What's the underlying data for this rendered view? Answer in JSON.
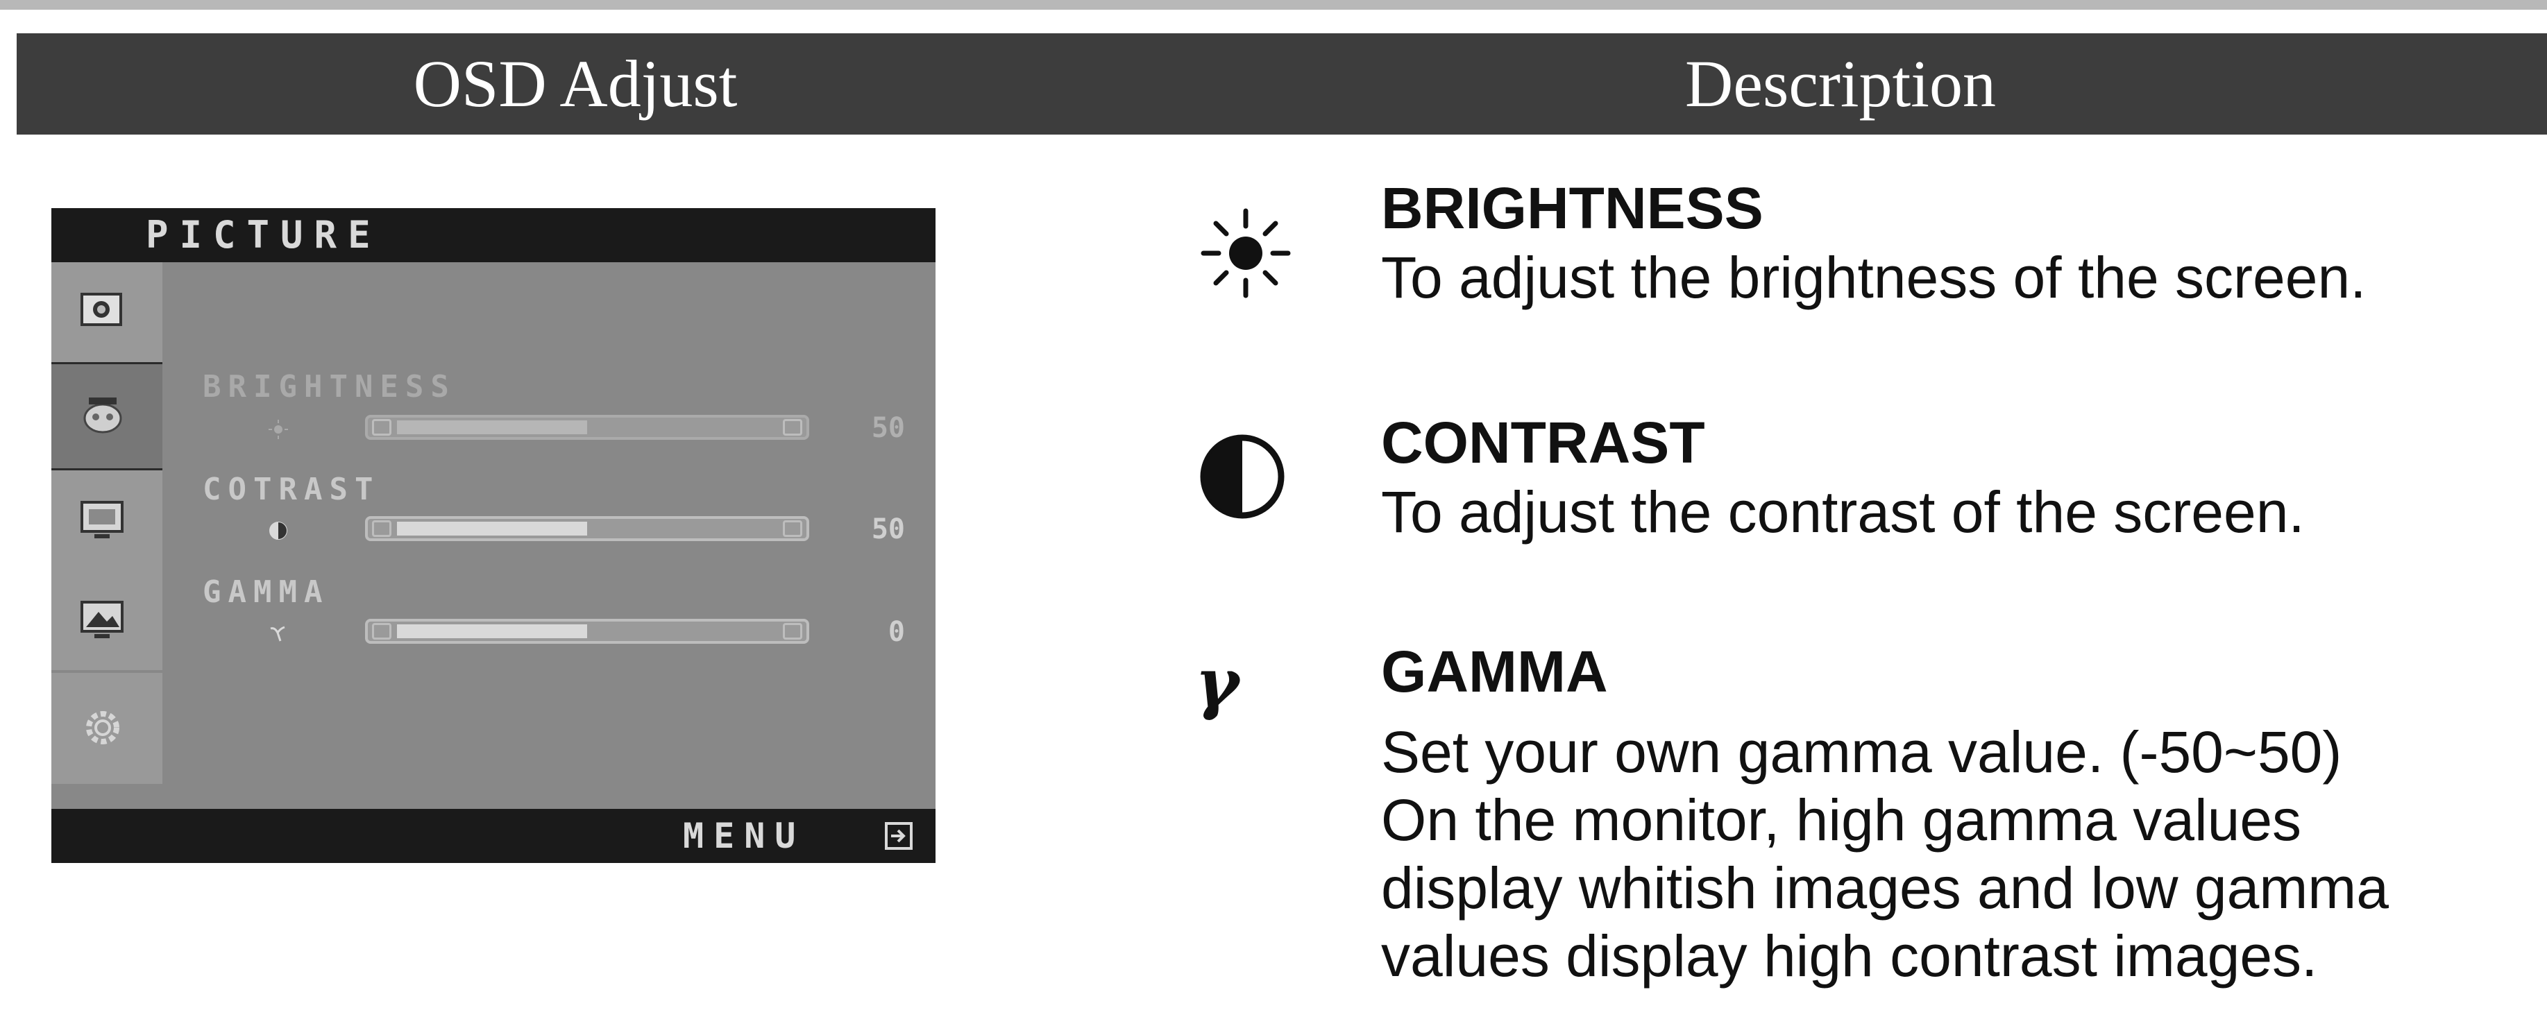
{
  "header": {
    "left_label": "OSD Adjust",
    "right_label": "Description"
  },
  "osd": {
    "title": "PICTURE",
    "menu_label": "MENU",
    "sidebar_icons": [
      "picture-icon",
      "color-icon",
      "screen-position-icon",
      "image-quality-icon",
      "settings-gear-icon"
    ],
    "items": [
      {
        "label": "BRIGHTNESS",
        "icon": "sun-icon",
        "value": "50",
        "level": 0.5
      },
      {
        "label": "COTRAST",
        "icon": "contrast-icon",
        "value": "50",
        "level": 0.5
      },
      {
        "label": "GAMMA",
        "icon": "gamma-icon",
        "value": "0",
        "level": 0.5
      }
    ]
  },
  "descriptions": [
    {
      "icon": "sun-icon",
      "title": "BRIGHTNESS",
      "lines": [
        "To adjust the brightness of the screen."
      ]
    },
    {
      "icon": "contrast-icon",
      "title": "CONTRAST",
      "lines": [
        "To adjust the contrast of the screen."
      ]
    },
    {
      "icon": "gamma-icon",
      "glyph": "γ",
      "title": "GAMMA",
      "lines": [
        "Set your own gamma value. (-50~50)",
        "On the monitor, high gamma values",
        "display whitish images and low gamma",
        "values display high contrast images."
      ]
    }
  ]
}
